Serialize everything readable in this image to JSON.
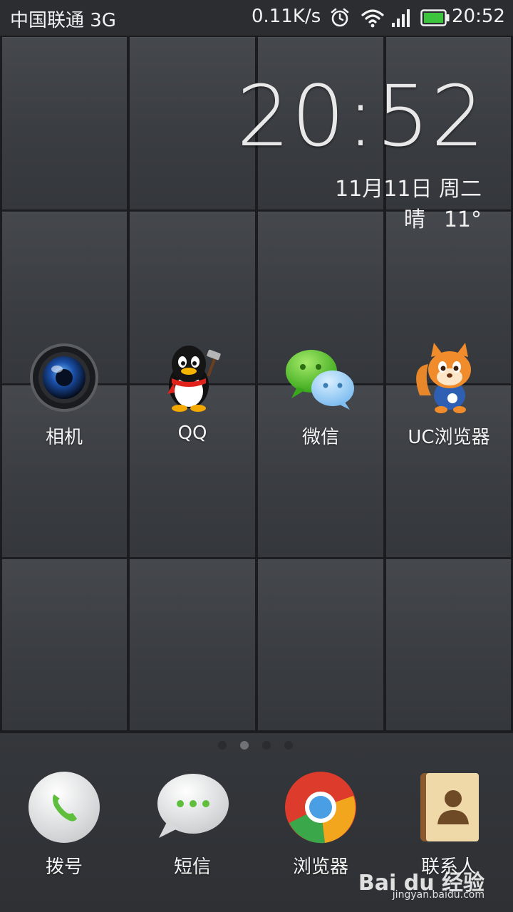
{
  "status_bar": {
    "carrier": "中国联通 3G",
    "net_speed": "0.11K/s",
    "time": "20:52",
    "icons": [
      "alarm-icon",
      "wifi-icon",
      "signal-icon",
      "battery-icon"
    ],
    "battery_color": "#3cc43c"
  },
  "clock_widget": {
    "time": "20:52",
    "date": "11月11日 周二",
    "weather": "晴",
    "temperature": "11°"
  },
  "apps": [
    {
      "label": "相机",
      "icon": "camera-icon"
    },
    {
      "label": "QQ",
      "icon": "qq-penguin-icon"
    },
    {
      "label": "微信",
      "icon": "wechat-icon"
    },
    {
      "label": "UC浏览器",
      "icon": "uc-squirrel-icon"
    }
  ],
  "page_indicator": {
    "pages": 4,
    "current": 2
  },
  "dock": [
    {
      "label": "拨号",
      "icon": "phone-icon"
    },
    {
      "label": "短信",
      "icon": "message-icon"
    },
    {
      "label": "浏览器",
      "icon": "browser-icon"
    },
    {
      "label": "联系人",
      "icon": "contacts-icon"
    }
  ],
  "watermark": {
    "brand": "Bai du 经验",
    "url": "jingyan.baidu.com"
  }
}
